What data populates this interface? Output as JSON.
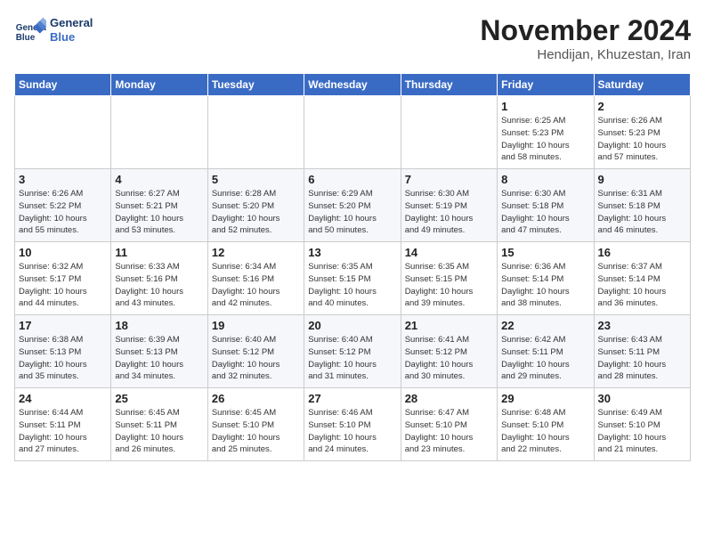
{
  "header": {
    "logo_line1": "General",
    "logo_line2": "Blue",
    "month": "November 2024",
    "location": "Hendijan, Khuzestan, Iran"
  },
  "weekdays": [
    "Sunday",
    "Monday",
    "Tuesday",
    "Wednesday",
    "Thursday",
    "Friday",
    "Saturday"
  ],
  "weeks": [
    [
      {
        "day": "",
        "info": ""
      },
      {
        "day": "",
        "info": ""
      },
      {
        "day": "",
        "info": ""
      },
      {
        "day": "",
        "info": ""
      },
      {
        "day": "",
        "info": ""
      },
      {
        "day": "1",
        "info": "Sunrise: 6:25 AM\nSunset: 5:23 PM\nDaylight: 10 hours\nand 58 minutes."
      },
      {
        "day": "2",
        "info": "Sunrise: 6:26 AM\nSunset: 5:23 PM\nDaylight: 10 hours\nand 57 minutes."
      }
    ],
    [
      {
        "day": "3",
        "info": "Sunrise: 6:26 AM\nSunset: 5:22 PM\nDaylight: 10 hours\nand 55 minutes."
      },
      {
        "day": "4",
        "info": "Sunrise: 6:27 AM\nSunset: 5:21 PM\nDaylight: 10 hours\nand 53 minutes."
      },
      {
        "day": "5",
        "info": "Sunrise: 6:28 AM\nSunset: 5:20 PM\nDaylight: 10 hours\nand 52 minutes."
      },
      {
        "day": "6",
        "info": "Sunrise: 6:29 AM\nSunset: 5:20 PM\nDaylight: 10 hours\nand 50 minutes."
      },
      {
        "day": "7",
        "info": "Sunrise: 6:30 AM\nSunset: 5:19 PM\nDaylight: 10 hours\nand 49 minutes."
      },
      {
        "day": "8",
        "info": "Sunrise: 6:30 AM\nSunset: 5:18 PM\nDaylight: 10 hours\nand 47 minutes."
      },
      {
        "day": "9",
        "info": "Sunrise: 6:31 AM\nSunset: 5:18 PM\nDaylight: 10 hours\nand 46 minutes."
      }
    ],
    [
      {
        "day": "10",
        "info": "Sunrise: 6:32 AM\nSunset: 5:17 PM\nDaylight: 10 hours\nand 44 minutes."
      },
      {
        "day": "11",
        "info": "Sunrise: 6:33 AM\nSunset: 5:16 PM\nDaylight: 10 hours\nand 43 minutes."
      },
      {
        "day": "12",
        "info": "Sunrise: 6:34 AM\nSunset: 5:16 PM\nDaylight: 10 hours\nand 42 minutes."
      },
      {
        "day": "13",
        "info": "Sunrise: 6:35 AM\nSunset: 5:15 PM\nDaylight: 10 hours\nand 40 minutes."
      },
      {
        "day": "14",
        "info": "Sunrise: 6:35 AM\nSunset: 5:15 PM\nDaylight: 10 hours\nand 39 minutes."
      },
      {
        "day": "15",
        "info": "Sunrise: 6:36 AM\nSunset: 5:14 PM\nDaylight: 10 hours\nand 38 minutes."
      },
      {
        "day": "16",
        "info": "Sunrise: 6:37 AM\nSunset: 5:14 PM\nDaylight: 10 hours\nand 36 minutes."
      }
    ],
    [
      {
        "day": "17",
        "info": "Sunrise: 6:38 AM\nSunset: 5:13 PM\nDaylight: 10 hours\nand 35 minutes."
      },
      {
        "day": "18",
        "info": "Sunrise: 6:39 AM\nSunset: 5:13 PM\nDaylight: 10 hours\nand 34 minutes."
      },
      {
        "day": "19",
        "info": "Sunrise: 6:40 AM\nSunset: 5:12 PM\nDaylight: 10 hours\nand 32 minutes."
      },
      {
        "day": "20",
        "info": "Sunrise: 6:40 AM\nSunset: 5:12 PM\nDaylight: 10 hours\nand 31 minutes."
      },
      {
        "day": "21",
        "info": "Sunrise: 6:41 AM\nSunset: 5:12 PM\nDaylight: 10 hours\nand 30 minutes."
      },
      {
        "day": "22",
        "info": "Sunrise: 6:42 AM\nSunset: 5:11 PM\nDaylight: 10 hours\nand 29 minutes."
      },
      {
        "day": "23",
        "info": "Sunrise: 6:43 AM\nSunset: 5:11 PM\nDaylight: 10 hours\nand 28 minutes."
      }
    ],
    [
      {
        "day": "24",
        "info": "Sunrise: 6:44 AM\nSunset: 5:11 PM\nDaylight: 10 hours\nand 27 minutes."
      },
      {
        "day": "25",
        "info": "Sunrise: 6:45 AM\nSunset: 5:11 PM\nDaylight: 10 hours\nand 26 minutes."
      },
      {
        "day": "26",
        "info": "Sunrise: 6:45 AM\nSunset: 5:10 PM\nDaylight: 10 hours\nand 25 minutes."
      },
      {
        "day": "27",
        "info": "Sunrise: 6:46 AM\nSunset: 5:10 PM\nDaylight: 10 hours\nand 24 minutes."
      },
      {
        "day": "28",
        "info": "Sunrise: 6:47 AM\nSunset: 5:10 PM\nDaylight: 10 hours\nand 23 minutes."
      },
      {
        "day": "29",
        "info": "Sunrise: 6:48 AM\nSunset: 5:10 PM\nDaylight: 10 hours\nand 22 minutes."
      },
      {
        "day": "30",
        "info": "Sunrise: 6:49 AM\nSunset: 5:10 PM\nDaylight: 10 hours\nand 21 minutes."
      }
    ]
  ]
}
